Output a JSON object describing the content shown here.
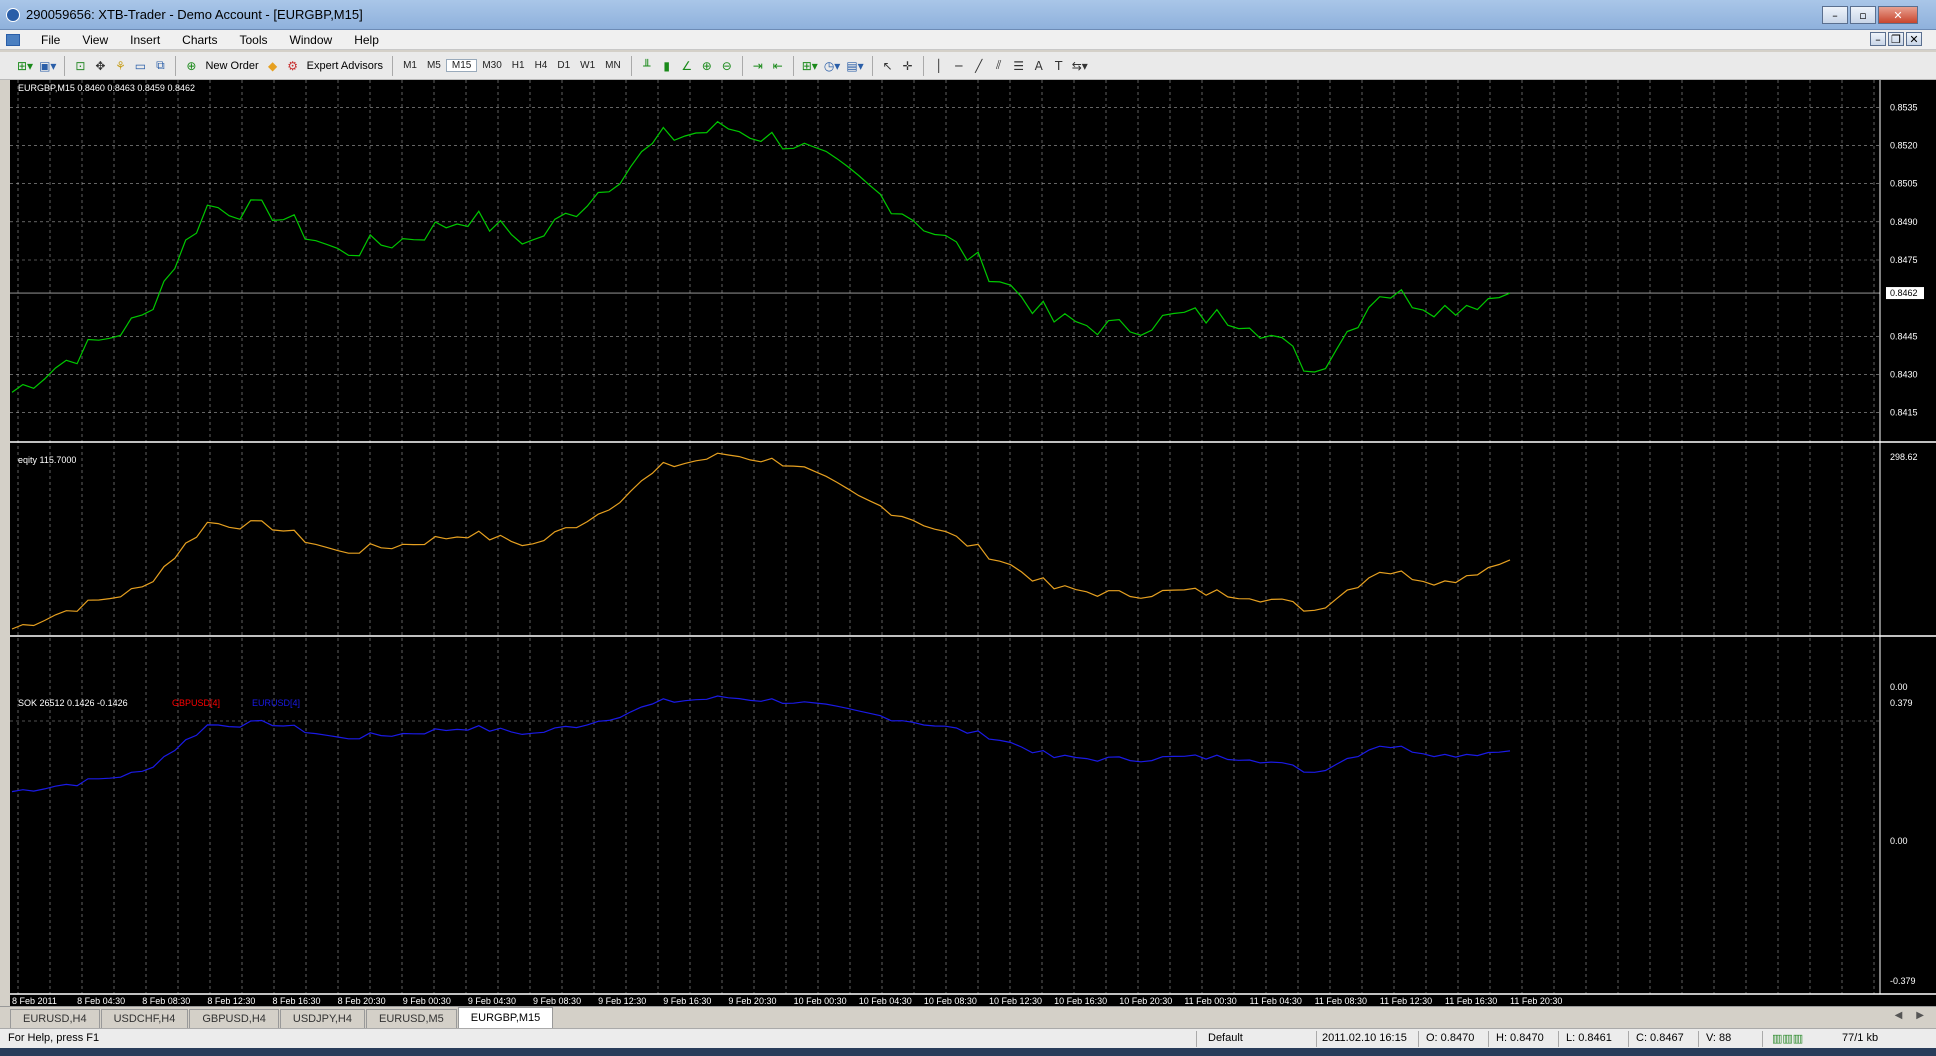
{
  "window": {
    "title": "290059656: XTB-Trader - Demo Account - [EURGBP,M15]"
  },
  "menu": [
    "File",
    "View",
    "Insert",
    "Charts",
    "Tools",
    "Window",
    "Help"
  ],
  "toolbar": {
    "new_order": "New Order",
    "expert_advisors": "Expert Advisors",
    "timeframes": [
      "M1",
      "M5",
      "M15",
      "M30",
      "H1",
      "H4",
      "D1",
      "W1",
      "MN"
    ],
    "active_timeframe": "M15"
  },
  "colors": {
    "price": "#00c800",
    "equity": "#e6a020",
    "sok_gbpusd": "#ff0000",
    "sok_eurusd": "#1a1ae6",
    "grid": "#c8c8c8",
    "background": "#000000"
  },
  "chart": {
    "main_label": "EURGBP,M15  0.8460 0.8463 0.8459 0.8462",
    "current_price": "0.8462",
    "price_ticks": [
      "0.8535",
      "0.8520",
      "0.8505",
      "0.8490",
      "0.8475",
      "0.8445",
      "0.8430",
      "0.8415"
    ],
    "equity_label": "eqity 115.7000",
    "equity_top": "298.62",
    "equity_bottom": "0.00",
    "sok_label": "SOK 26512 0.1426 -0.1426",
    "sok_legend": [
      "GBPUSD[4]",
      "EURUSD[4]"
    ],
    "sok_ticks": [
      "0.379",
      "0.00",
      "-0.379"
    ],
    "time_labels": [
      "8 Feb 2011",
      "8 Feb 04:30",
      "8 Feb 08:30",
      "8 Feb 12:30",
      "8 Feb 16:30",
      "8 Feb 20:30",
      "9 Feb 00:30",
      "9 Feb 04:30",
      "9 Feb 08:30",
      "9 Feb 12:30",
      "9 Feb 16:30",
      "9 Feb 20:30",
      "10 Feb 00:30",
      "10 Feb 04:30",
      "10 Feb 08:30",
      "10 Feb 12:30",
      "10 Feb 16:30",
      "10 Feb 20:30",
      "11 Feb 00:30",
      "11 Feb 04:30",
      "11 Feb 08:30",
      "11 Feb 12:30",
      "11 Feb 16:30",
      "11 Feb 20:30"
    ]
  },
  "chart_data": {
    "type": "line",
    "x": [
      "8 Feb 2011",
      "8 Feb 04:30",
      "8 Feb 08:30",
      "8 Feb 12:30",
      "8 Feb 16:30",
      "8 Feb 20:30",
      "9 Feb 00:30",
      "9 Feb 04:30",
      "9 Feb 08:30",
      "9 Feb 12:30",
      "9 Feb 16:30",
      "9 Feb 20:30",
      "10 Feb 00:30",
      "10 Feb 04:30",
      "10 Feb 08:30",
      "10 Feb 12:30",
      "10 Feb 16:30",
      "10 Feb 20:30",
      "11 Feb 00:30",
      "11 Feb 04:30",
      "11 Feb 08:30",
      "11 Feb 12:30",
      "11 Feb 16:30",
      "11 Feb 20:30"
    ],
    "series": [
      {
        "name": "EURGBP,M15",
        "values": [
          0.8423,
          0.8438,
          0.8452,
          0.8496,
          0.8494,
          0.8478,
          0.8483,
          0.8492,
          0.8482,
          0.8502,
          0.8523,
          0.8527,
          0.8521,
          0.8506,
          0.8489,
          0.8471,
          0.8451,
          0.8448,
          0.8453,
          0.8452,
          0.8431,
          0.8463,
          0.8456,
          0.8462
        ]
      },
      {
        "name": "eqity",
        "values": [
          5,
          40,
          70,
          175,
          170,
          128,
          140,
          158,
          140,
          190,
          265,
          285,
          270,
          215,
          175,
          125,
          70,
          60,
          65,
          60,
          35,
          100,
          80,
          115.7
        ]
      },
      {
        "name": "GBPUSD[4]",
        "values": []
      },
      {
        "name": "EURUSD[4]",
        "values": [
          -0.33,
          -0.29,
          -0.24,
          -0.02,
          -0.01,
          -0.08,
          -0.06,
          -0.03,
          -0.06,
          0.0,
          0.09,
          0.11,
          0.09,
          0.04,
          -0.01,
          -0.07,
          -0.17,
          -0.18,
          -0.17,
          -0.17,
          -0.24,
          -0.11,
          -0.16,
          -0.14
        ]
      }
    ],
    "y_ranges": {
      "price": [
        0.8405,
        0.8545
      ],
      "equity": [
        0,
        298.62
      ],
      "sok": [
        -0.379,
        0.379
      ]
    },
    "grid": true
  },
  "tabs": [
    "EURUSD,H4",
    "USDCHF,H4",
    "GBPUSD,H4",
    "USDJPY,H4",
    "EURUSD,M5",
    "EURGBP,M15"
  ],
  "active_tab": "EURGBP,M15",
  "status": {
    "help": "For Help, press F1",
    "profile": "Default",
    "datetime": "2011.02.10 16:15",
    "open": "O: 0.8470",
    "high": "H: 0.8470",
    "low": "L: 0.8461",
    "close": "C: 0.8467",
    "volume": "V: 88",
    "traffic": "77/1 kb"
  }
}
